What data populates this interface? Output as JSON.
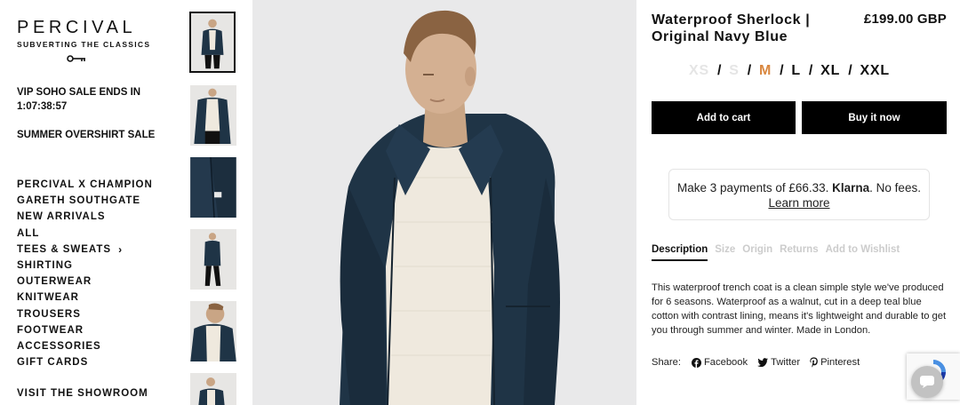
{
  "brand": {
    "name": "PERCIVAL",
    "tagline": "SUBVERTING THE CLASSICS"
  },
  "promos": {
    "sale_countdown": "VIP SOHO SALE ENDS IN 1:07:38:57",
    "overshirt_sale": "SUMMER OVERSHIRT SALE"
  },
  "nav": {
    "items": [
      "PERCIVAL X CHAMPION",
      "GARETH SOUTHGATE",
      "NEW ARRIVALS",
      "ALL",
      "TEES & SWEATS",
      "SHIRTING",
      "OUTERWEAR",
      "KNITWEAR",
      "TROUSERS",
      "FOOTWEAR",
      "ACCESSORIES",
      "GIFT CARDS"
    ],
    "showroom": "VISIT THE SHOWROOM"
  },
  "product": {
    "title": "Waterproof Sherlock | Original Navy Blue",
    "price": "£199.00 GBP",
    "sizes": [
      {
        "label": "XS",
        "state": "unavailable"
      },
      {
        "label": "S",
        "state": "unavailable"
      },
      {
        "label": "M",
        "state": "selected"
      },
      {
        "label": "L",
        "state": "available"
      },
      {
        "label": "XL",
        "state": "available"
      },
      {
        "label": "XXL",
        "state": "available"
      }
    ],
    "size_separator": "/",
    "add_to_cart": "Add to cart",
    "buy_now": "Buy it now"
  },
  "klarna": {
    "text_before": "Make 3 payments of £66.33. ",
    "brand": "Klarna",
    "text_after": ". No fees. ",
    "link": "Learn more"
  },
  "tabs": [
    "Description",
    "Size",
    "Origin",
    "Returns",
    "Add to Wishlist"
  ],
  "description": "This waterproof trench coat is a clean simple style we've produced for 6 seasons. Waterproof as a walnut, cut in a deep teal blue cotton with contrast lining, means it's lightweight and durable to get you through summer and winter. Made in London.",
  "share": {
    "label": "Share:",
    "facebook": "Facebook",
    "twitter": "Twitter",
    "pinterest": "Pinterest"
  },
  "colors": {
    "selected_size": "#d9873f",
    "button_bg": "#000000",
    "coat_navy": "#1f3446",
    "sweater_cream": "#efe9de"
  }
}
